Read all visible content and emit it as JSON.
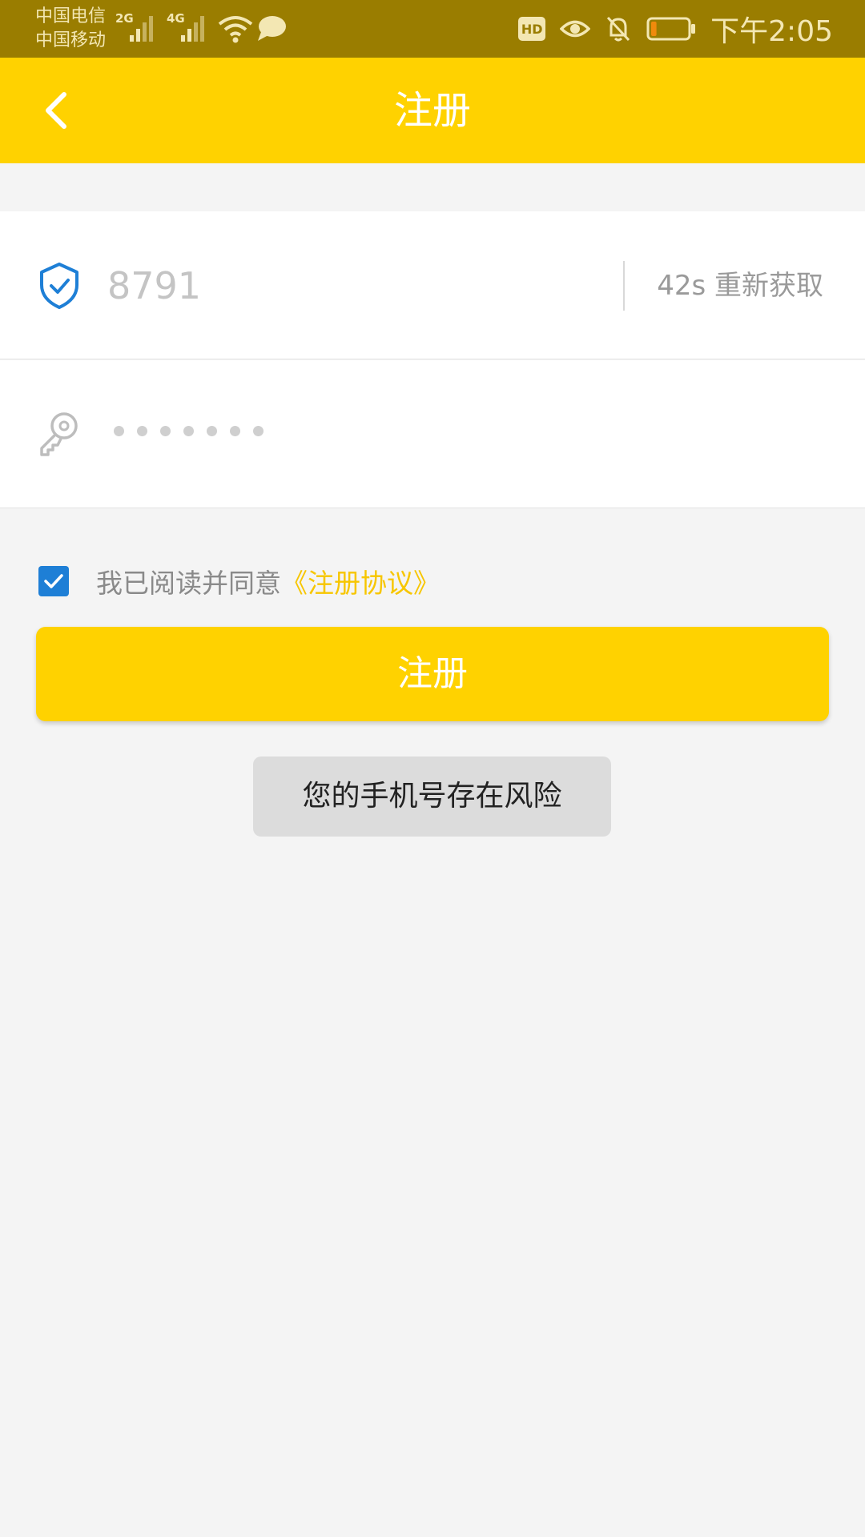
{
  "status_bar": {
    "carrier_1": "中国电信",
    "carrier_2": "中国移动",
    "network_1": "2G",
    "network_2": "4G",
    "hd_label": "HD",
    "time": "下午2:05",
    "icons": [
      "signal-icon",
      "wifi-icon",
      "chat-bubble-icon",
      "eye-icon",
      "bell-off-icon",
      "battery-icon"
    ],
    "battery_level": 0.15
  },
  "app_bar": {
    "title": "注册",
    "back_icon": "chevron-left-icon"
  },
  "form": {
    "code": {
      "icon": "shield-check-icon",
      "value": "8791",
      "resend_label": "42s 重新获取"
    },
    "password": {
      "icon": "key-icon",
      "masked_length": 7
    }
  },
  "agreement": {
    "checked": true,
    "text": "我已阅读并同意",
    "link_text": "《注册协议》"
  },
  "register_button": {
    "label": "注册"
  },
  "toast": {
    "message": "您的手机号存在风险"
  },
  "colors": {
    "accent": "#ffd200",
    "status_bar": "#9a7d00",
    "link": "#f7c600",
    "checkbox": "#1e7fd6",
    "background": "#f4f4f4"
  }
}
